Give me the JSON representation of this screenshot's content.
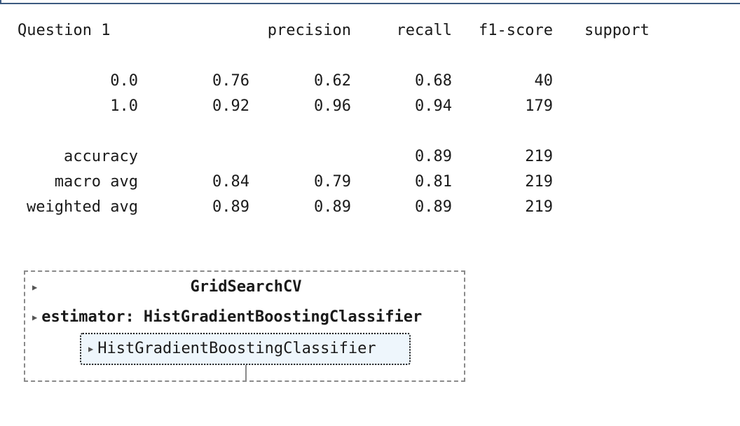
{
  "report": {
    "header": {
      "title": "Question 1",
      "precision": "precision",
      "recall": "recall",
      "f1": "f1-score",
      "support": "support"
    },
    "rows": [
      {
        "label": "0.0",
        "precision": "0.76",
        "recall": "0.62",
        "f1": "0.68",
        "support": "40"
      },
      {
        "label": "1.0",
        "precision": "0.92",
        "recall": "0.96",
        "f1": "0.94",
        "support": "179"
      }
    ],
    "summary": [
      {
        "label": "accuracy",
        "precision": "",
        "recall": "",
        "f1": "0.89",
        "support": "219"
      },
      {
        "label": "macro avg",
        "precision": "0.84",
        "recall": "0.79",
        "f1": "0.81",
        "support": "219"
      },
      {
        "label": "weighted avg",
        "precision": "0.89",
        "recall": "0.89",
        "f1": "0.89",
        "support": "219"
      }
    ]
  },
  "estimator": {
    "gridsearch_label": "GridSearchCV",
    "estimator_label": "estimator: HistGradientBoostingClassifier",
    "inner_label": "HistGradientBoostingClassifier",
    "toggle_icon": "triangle-right-icon"
  },
  "colors": {
    "top_border": "#3d5a80",
    "inner_box_bg": "#eef6fc",
    "dashed_border": "#8a8a8a"
  }
}
